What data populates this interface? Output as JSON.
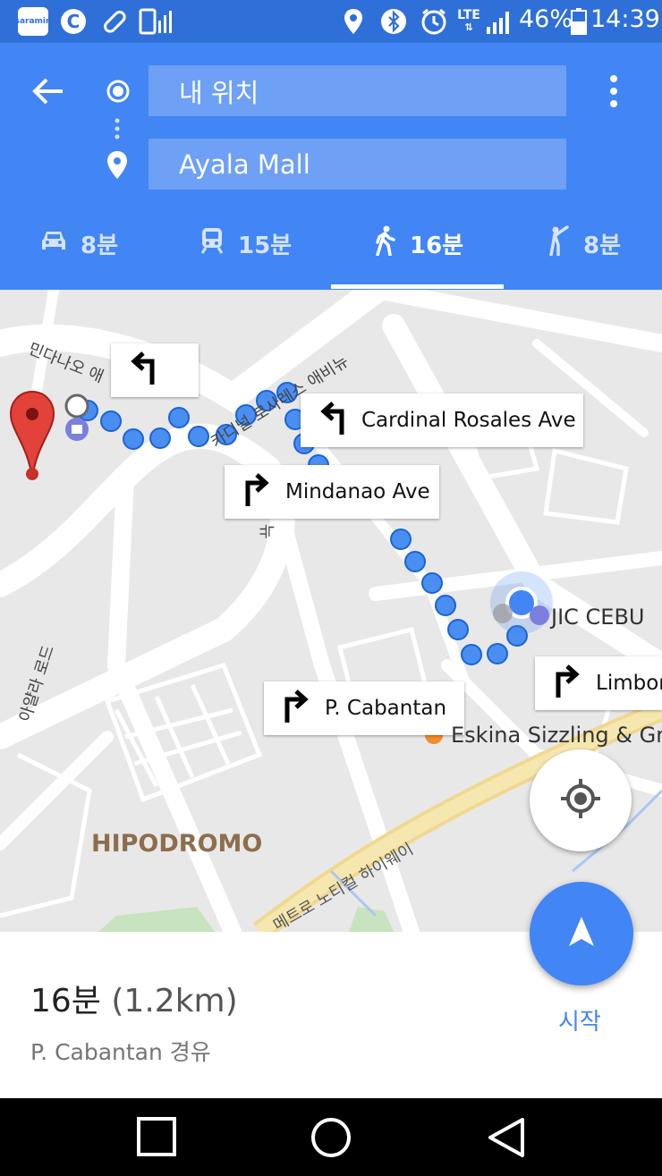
{
  "status_bar": {
    "app_badge": "saramin",
    "battery_percent": "46%",
    "time": "14:39",
    "network": "LTE",
    "icons": [
      "saramin-icon",
      "c-app-icon",
      "pill-icon",
      "phone-signal-icon",
      "location-icon",
      "bluetooth-icon",
      "alarm-icon",
      "lte-icon",
      "signal-icon",
      "battery-icon"
    ]
  },
  "header": {
    "origin_value": "내 위치",
    "destination_value": "Ayala Mall",
    "tabs": [
      {
        "mode": "car",
        "label": "8분"
      },
      {
        "mode": "transit",
        "label": "15분"
      },
      {
        "mode": "walk",
        "label": "16분"
      },
      {
        "mode": "ride",
        "label": "8분"
      }
    ],
    "active_tab": "walk"
  },
  "map": {
    "callouts": [
      {
        "turn": "left",
        "label": ""
      },
      {
        "turn": "left",
        "label": "Cardinal Rosales Ave"
      },
      {
        "turn": "right",
        "label": "Mindanao Ave"
      },
      {
        "turn": "right",
        "label": "P. Cabantan"
      },
      {
        "turn": "right",
        "label": "Limbor"
      }
    ],
    "labels": {
      "jic": "JIC CEBU",
      "eskina": "Eskina Sizzling & Gri",
      "hipodromo": "HIPODROMO",
      "mindanao_kr": "민다나오 애",
      "cardinal_kr": "카디널 로사레스 애비뉴",
      "ave_kr": "뉴",
      "ayala_kr": "아얄라 로드",
      "highway_kr": "메트로 노티컬 하이웨이"
    },
    "accent": "#4285f4"
  },
  "summary": {
    "duration": "16분",
    "distance": "(1.2km)",
    "via": "P. Cabantan 경유",
    "start_label": "시작"
  }
}
